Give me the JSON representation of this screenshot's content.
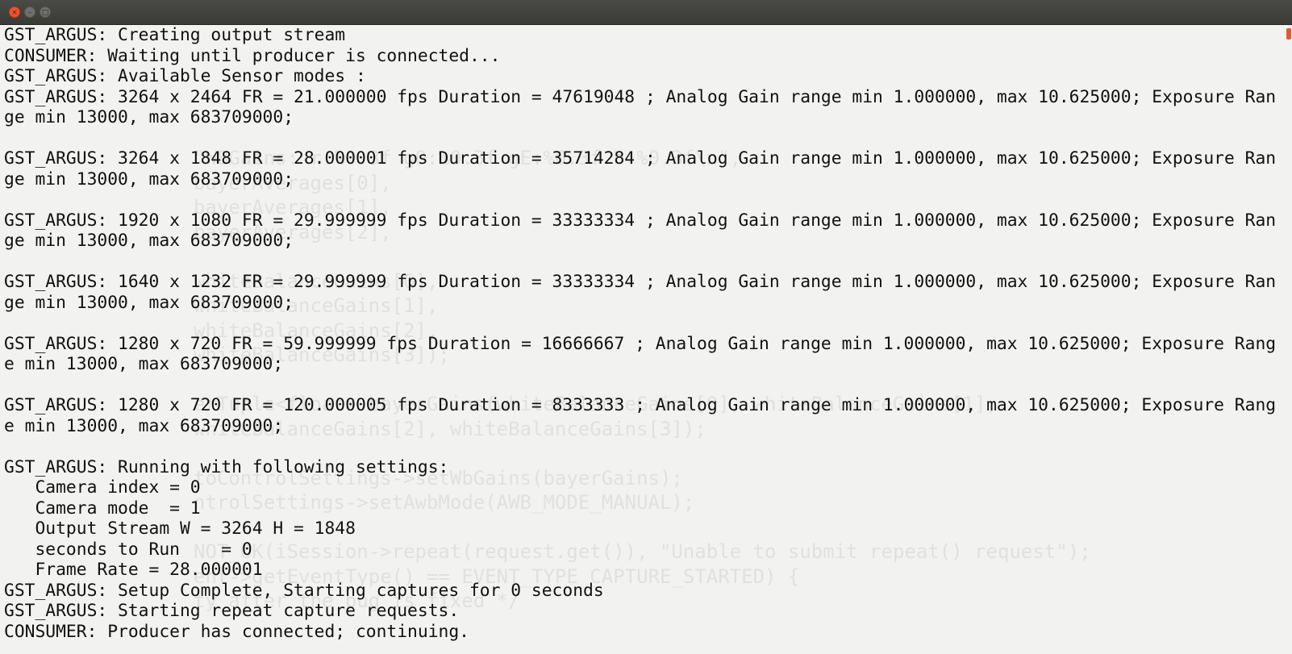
{
  "window": {
    "controls": {
      "close_glyph": "×",
      "minimize_glyph": "–",
      "maximize_glyph": "□"
    }
  },
  "terminal": {
    "lines": [
      "GST_ARGUS: Creating output stream",
      "CONSUMER: Waiting until producer is connected...",
      "GST_ARGUS: Available Sensor modes :",
      "GST_ARGUS: 3264 x 2464 FR = 21.000000 fps Duration = 47619048 ; Analog Gain range min 1.000000, max 10.625000; Exposure Range min 13000, max 683709000;",
      "",
      "GST_ARGUS: 3264 x 1848 FR = 28.000001 fps Duration = 35714284 ; Analog Gain range min 1.000000, max 10.625000; Exposure Range min 13000, max 683709000;",
      "",
      "GST_ARGUS: 1920 x 1080 FR = 29.999999 fps Duration = 33333334 ; Analog Gain range min 1.000000, max 10.625000; Exposure Range min 13000, max 683709000;",
      "",
      "GST_ARGUS: 1640 x 1232 FR = 29.999999 fps Duration = 33333334 ; Analog Gain range min 1.000000, max 10.625000; Exposure Range min 13000, max 683709000;",
      "",
      "GST_ARGUS: 1280 x 720 FR = 59.999999 fps Duration = 16666667 ; Analog Gain range min 1.000000, max 10.625000; Exposure Range min 13000, max 683709000;",
      "",
      "GST_ARGUS: 1280 x 720 FR = 120.000005 fps Duration = 8333333 ; Analog Gain range min 1.000000, max 10.625000; Exposure Range min 13000, max 683709000;",
      "",
      "GST_ARGUS: Running with following settings:",
      "   Camera index = 0",
      "   Camera mode  = 1",
      "   Output Stream W = 3264 H = 1848",
      "   seconds to Run    = 0",
      "   Frame Rate = 28.000001",
      "GST_ARGUS: Setup Complete, Starting captures for 0 seconds",
      "GST_ARGUS: Starting repeat capture requests.",
      "CONSUMER: Producer has connected; continuing."
    ]
  },
  "background_code": {
    "lines": [
      "\"WBGains: r:%0.3f gO:%0.3f gE:%0.3f b:%0.3f\\n\",",
      "bayerAverages[0],",
      "bayerAverages[1],",
      "bayerAverages[2],",
      "",
      "whiteBalanceGains[0],",
      "whiteBalanceGains[1],",
      "whiteBalanceGains[2],",
      "whiteBalanceGains[3]);",
      "",
      "erTuple<float> bayerGains(whiteBalanceGains[0], whiteBalanceGains[1],",
      "whiteBalanceGains[2], whiteBalanceGains[3]);",
      "",
      "toControlSettings->setWbGains(bayerGains);",
      "ntrolSettings->setAwbMode(AWB_MODE_MANUAL);",
      "",
      "NOT_OK(iSession->repeat(request.get()), \"Unable to submit repeat() request\");",
      "ent->getEventType() == EVENT_TYPE_CAPTURE_STARTED) {",
      "ty after the bug is fixed */"
    ]
  }
}
